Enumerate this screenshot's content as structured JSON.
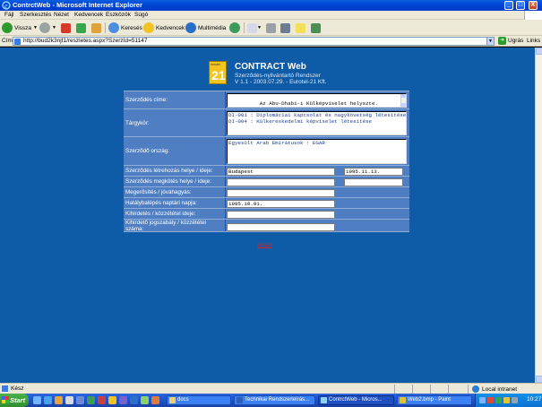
{
  "window": {
    "title": "ContrctWeb - Microsoft Internet Explorer",
    "minimize": "_",
    "maximize": "□",
    "close": "X"
  },
  "menu": [
    "Fájl",
    "Szerkesztés",
    "Nézet",
    "Kedvencek",
    "Eszközök",
    "Súgó"
  ],
  "toolbar": {
    "back": "Vissza",
    "search": "Keresés",
    "favorites": "Kedvencek",
    "media": "Multimédia"
  },
  "address": {
    "label": "Cím",
    "url": "http://bud2k3njf1/reszletes.aspx?SzerzId=51147",
    "go": "Ugrás",
    "links": "Links"
  },
  "app": {
    "logo_small": "eurotel",
    "logo_num": "21",
    "title": "CONTRACT Web",
    "subtitle": "Szerződés-nyilvántartó Rendszer",
    "version": "V 1.1 - 2003.07.29. - Eurotel-21 Kft."
  },
  "form": {
    "title_label": "Szerződés címe:",
    "title_value": "Az Abu-Dhabi-i Külképviselet helyszte.",
    "subject_label": "Tárgykör:",
    "subject_value": "DI-001 : Diplomáciai kapcsolat és nagykövetség létesítése\nDI-004 : Külkereskedelmi képviselet létesítése",
    "country_label": "Szerződő ország:",
    "country_value": "Egyesült Arab Emirátusok : EGAR",
    "creation_label": "Szerződés létrehozás helye / ideje:",
    "creation_place": "Budapest",
    "creation_date": "1995.11.13.",
    "renewal_label": "Szerződés megkötés helye / ideje:",
    "renewal_place": "",
    "renewal_date": "",
    "confirm_label": "Megerősítés / jóváhagyás:",
    "confirm_value": "",
    "effective_label": "Hatálybalépés naptári napja:",
    "effective_value": "1995.10.01.",
    "publication_label": "Kihirdetés / közzététel ideje:",
    "publication_value": "",
    "legislation_label": "Kihirdető jogszabály / közzététel száma:",
    "legislation_value": ""
  },
  "back_link": "vissza",
  "status": {
    "text": "Kész",
    "zone": "Local intranet"
  },
  "taskbar": {
    "start": "Start",
    "tasks": [
      "docs",
      "Technikai Rendszerleírás...",
      "ContrctWeb - Micros...",
      "Web2.bmp - Paint"
    ],
    "clock": "10:27"
  }
}
